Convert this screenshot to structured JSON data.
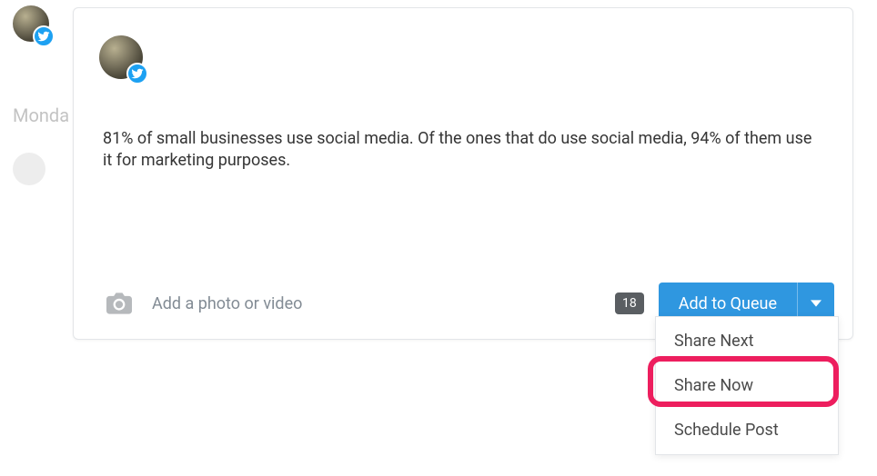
{
  "colors": {
    "primary": "#2f97e0",
    "twitter": "#1da1f2",
    "highlight": "#ed1e5e"
  },
  "left": {
    "day_label": "Monda"
  },
  "composer": {
    "text": "81% of small businesses use social media. Of the ones that do use social media, 94% of them use it for marketing purposes.",
    "media_hint": "Add a photo or video",
    "char_count": "18",
    "queue_button_label": "Add to Queue"
  },
  "dropdown": {
    "items": [
      {
        "label": "Share Next"
      },
      {
        "label": "Share Now"
      },
      {
        "label": "Schedule Post"
      }
    ]
  },
  "icons": {
    "twitter": "twitter-icon",
    "camera": "camera-icon",
    "caret": "chevron-down-icon"
  }
}
